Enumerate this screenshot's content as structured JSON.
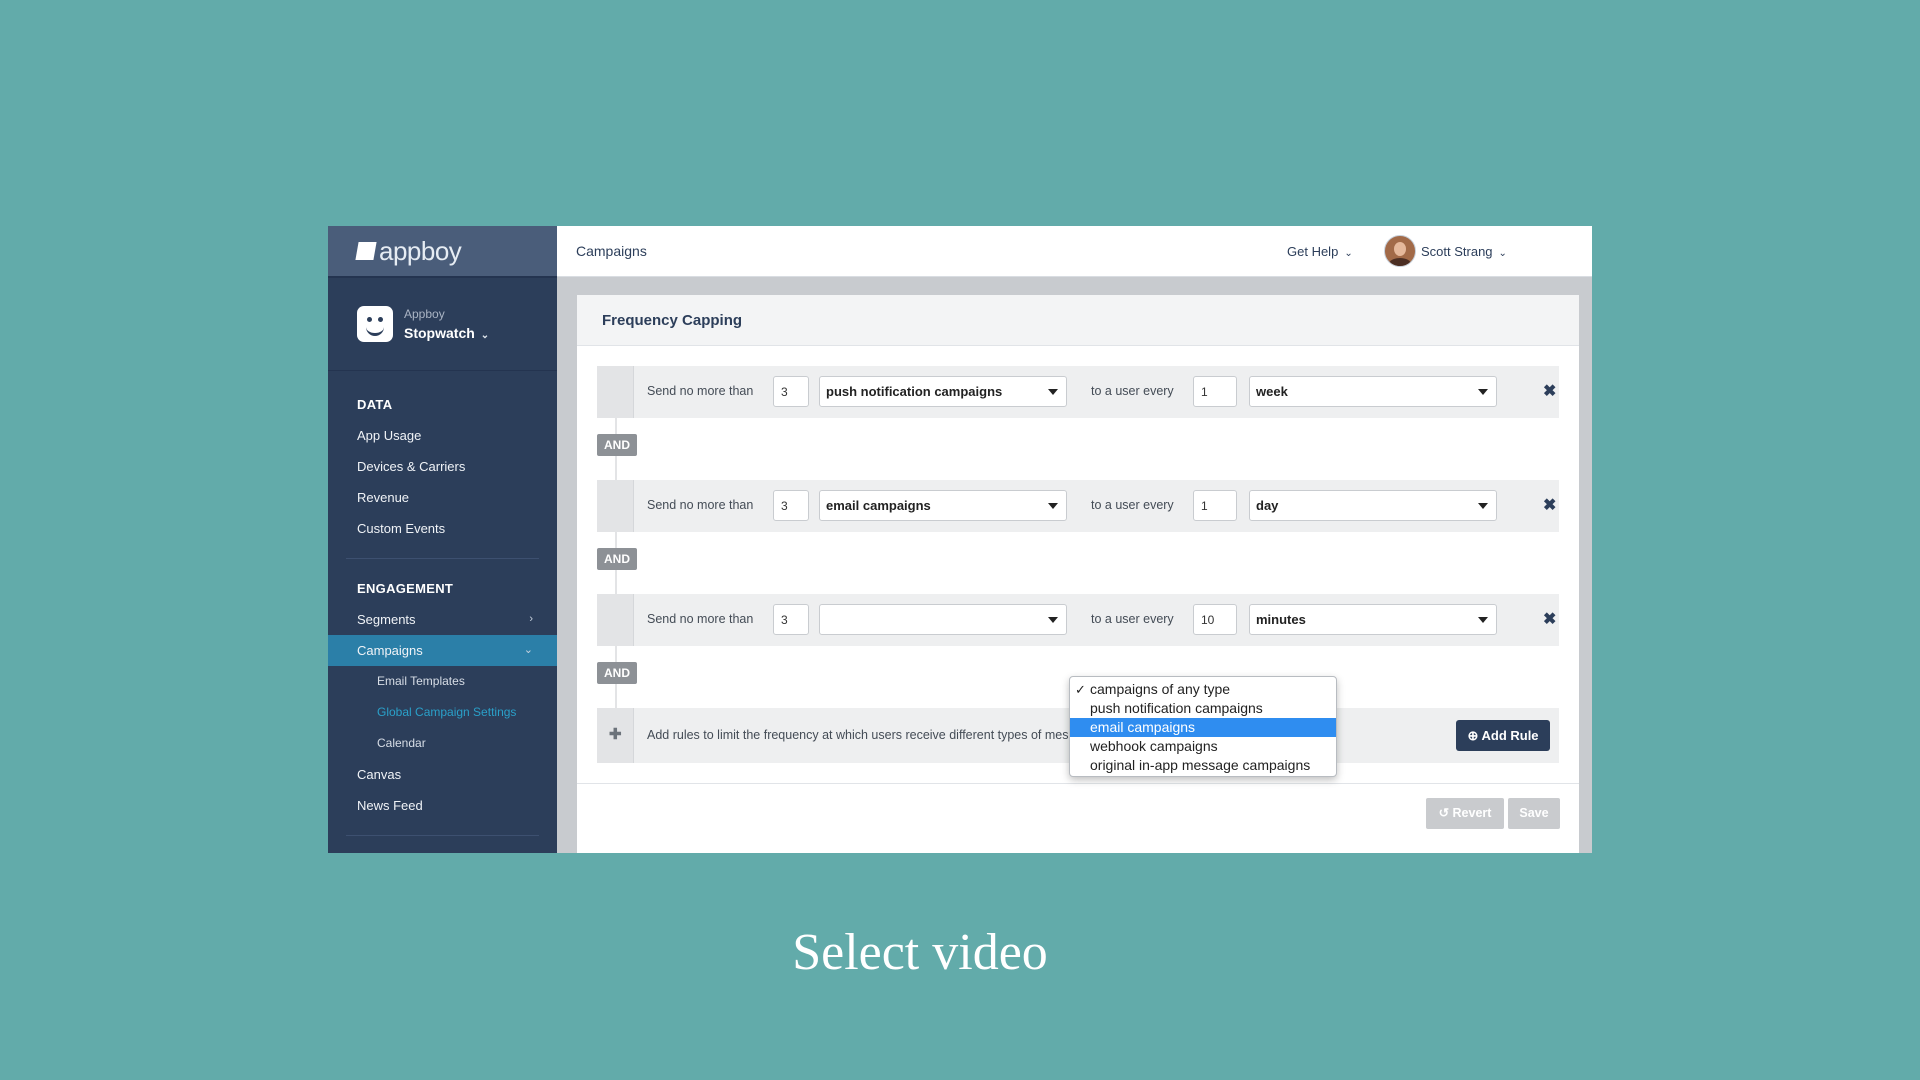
{
  "sidebar": {
    "logo_text": "appboy",
    "app_org": "Appboy",
    "app_name": "Stopwatch",
    "sections": {
      "data_heading": "DATA",
      "data_items": [
        "App Usage",
        "Devices & Carriers",
        "Revenue",
        "Custom Events"
      ],
      "engagement_heading": "ENGAGEMENT",
      "segments": "Segments",
      "campaigns": "Campaigns",
      "campaign_subitems": [
        "Email Templates",
        "Global Campaign Settings",
        "Calendar"
      ],
      "canvas": "Canvas",
      "news_feed": "News Feed"
    }
  },
  "topbar": {
    "breadcrumb": "Campaigns",
    "help": "Get Help",
    "user": "Scott Strang"
  },
  "panel": {
    "title": "Frequency Capping",
    "rules": [
      {
        "prefix": "Send no more than",
        "count": "3",
        "type": "push notification campaigns",
        "middle": "to a user every",
        "interval": "1",
        "unit": "week"
      },
      {
        "prefix": "Send no more than",
        "count": "3",
        "type": "email campaigns",
        "middle": "to a user every",
        "interval": "1",
        "unit": "day"
      },
      {
        "prefix": "Send no more than",
        "count": "3",
        "type": "",
        "middle": "to a user every",
        "interval": "10",
        "unit": "minutes"
      }
    ],
    "and_label": "AND",
    "add_text": "Add rules to limit the frequency at which users receive different types of messages.",
    "add_button": "Add Rule",
    "revert_button": "Revert",
    "save_button": "Save"
  },
  "dropdown": {
    "options": [
      "campaigns of any type",
      "push notification campaigns",
      "email campaigns",
      "webhook campaigns",
      "original in-app message campaigns"
    ],
    "checked_index": 0,
    "highlighted_index": 2
  },
  "caption": "Select video"
}
